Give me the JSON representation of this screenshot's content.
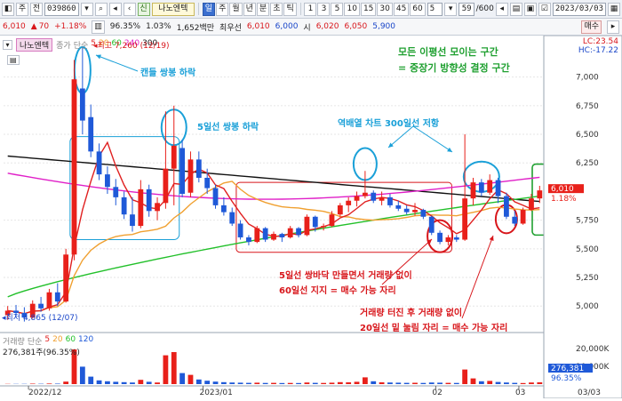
{
  "toolbar": {
    "tab_main": "주",
    "tab_period": "전",
    "code": "039860",
    "badge": "신",
    "stock_name": "나노엔텍",
    "periods": [
      "일",
      "주",
      "월",
      "년",
      "분",
      "초",
      "틱"
    ],
    "active_period": "일",
    "intervals": [
      "1",
      "3",
      "5",
      "10",
      "15",
      "30",
      "45",
      "60"
    ],
    "count": "5",
    "page": "59",
    "page_total": "/600",
    "date": "2023/03/03"
  },
  "quote": {
    "price": "6,010",
    "change": "70",
    "change_rate": "+1.18%",
    "volume_ratio": "96.35%",
    "turnover_rate": "1.03%",
    "amount": "1,652백만",
    "label_low": "최우선",
    "bid": "6,010",
    "ask": "6,000",
    "label_high": "시",
    "open": "6,020",
    "high": "6,050",
    "low": "5,900",
    "sell_btn": "매수"
  },
  "legend": {
    "price_title": "종가",
    "ma_type": "단순",
    "ma_periods": [
      "5",
      "20",
      "60",
      "240",
      "300"
    ],
    "lc": "LC:23.54",
    "hc": "HC:-17.22",
    "vol_title": "거래량",
    "vol_type": "단순",
    "vol_periods": [
      "5",
      "20",
      "60",
      "120"
    ],
    "vol_value": "276,381주(96.35%)"
  },
  "annotations": {
    "high_mark": "최고 7,260 (12/19)",
    "low_mark": "최저 4,865 (12/07)",
    "a1": "캔들 쌍봉 하락",
    "a2": "5일선 쌍봉 하락",
    "a3": "역배열 차트 300일선 저항",
    "a4_line1": "모든 이평선 모이는 구간",
    "a4_line2": "= 중장기 방향성 결정 구간",
    "a5_line1": "5일선 쌍바닥 만들면서 거래량 없이",
    "a5_line2": "60일선 지지 = 매수 가능 자리",
    "a6_line1": "거래량 터진 후 거래량 없이",
    "a6_line2": "20일선 밑 눌림 자리 = 매수 가능 자리"
  },
  "axis": {
    "price_ticks": [
      "7,000",
      "6,750",
      "6,500",
      "6,250",
      "5,750",
      "5,500",
      "5,250",
      "5,000"
    ],
    "current_price": "6,010",
    "current_rate": "1.18%",
    "vol_ticks": [
      "20,000K",
      "10,000K"
    ],
    "vol_current": "276,381",
    "vol_rate": "96.35%",
    "date_ticks": [
      "2022/12",
      "2023/01",
      "02",
      "03"
    ],
    "date_end": "03/03"
  },
  "colors": {
    "up": "#e8201a",
    "down": "#1f59d8",
    "ma5": "#e02020",
    "ma20": "#f0a030",
    "ma60": "#22c02a",
    "ma240": "#e020c8",
    "ma300": "#111111",
    "ann_blue": "#1aa0d8",
    "ann_red": "#d8161b",
    "ann_green": "#1fa030"
  },
  "chart_data": {
    "type": "candlestick",
    "price_range": [
      4800,
      7300
    ],
    "candles": [
      {
        "o": 4920,
        "h": 5000,
        "l": 4880,
        "c": 4960
      },
      {
        "o": 4960,
        "h": 5010,
        "l": 4900,
        "c": 4940
      },
      {
        "o": 4940,
        "h": 4990,
        "l": 4865,
        "c": 4900
      },
      {
        "o": 4900,
        "h": 5050,
        "l": 4890,
        "c": 5020
      },
      {
        "o": 5020,
        "h": 5080,
        "l": 4950,
        "c": 4980
      },
      {
        "o": 4980,
        "h": 5150,
        "l": 4960,
        "c": 5120
      },
      {
        "o": 5120,
        "h": 5200,
        "l": 5000,
        "c": 5040
      },
      {
        "o": 5040,
        "h": 5500,
        "l": 5030,
        "c": 5450
      },
      {
        "o": 5450,
        "h": 7150,
        "l": 5400,
        "c": 6980
      },
      {
        "o": 6900,
        "h": 7260,
        "l": 6500,
        "c": 6620
      },
      {
        "o": 6650,
        "h": 6760,
        "l": 6300,
        "c": 6350
      },
      {
        "o": 6350,
        "h": 6420,
        "l": 6100,
        "c": 6150
      },
      {
        "o": 6150,
        "h": 6220,
        "l": 5980,
        "c": 6040
      },
      {
        "o": 6040,
        "h": 6110,
        "l": 5880,
        "c": 5950
      },
      {
        "o": 5950,
        "h": 6000,
        "l": 5760,
        "c": 5800
      },
      {
        "o": 5800,
        "h": 5950,
        "l": 5650,
        "c": 5700
      },
      {
        "o": 5700,
        "h": 6100,
        "l": 5680,
        "c": 6020
      },
      {
        "o": 6020,
        "h": 6060,
        "l": 5780,
        "c": 5830
      },
      {
        "o": 5830,
        "h": 5950,
        "l": 5750,
        "c": 5900
      },
      {
        "o": 5900,
        "h": 6700,
        "l": 5850,
        "c": 6200
      },
      {
        "o": 6200,
        "h": 6750,
        "l": 5880,
        "c": 6400
      },
      {
        "o": 6380,
        "h": 6450,
        "l": 5950,
        "c": 5980
      },
      {
        "o": 5990,
        "h": 6350,
        "l": 5950,
        "c": 6280
      },
      {
        "o": 6280,
        "h": 6350,
        "l": 6080,
        "c": 6120
      },
      {
        "o": 6120,
        "h": 6200,
        "l": 5980,
        "c": 6030
      },
      {
        "o": 6030,
        "h": 6060,
        "l": 5850,
        "c": 5880
      },
      {
        "o": 5880,
        "h": 5950,
        "l": 5790,
        "c": 5820
      },
      {
        "o": 5820,
        "h": 5860,
        "l": 5700,
        "c": 5720
      },
      {
        "o": 5720,
        "h": 5750,
        "l": 5580,
        "c": 5600
      },
      {
        "o": 5600,
        "h": 5620,
        "l": 5530,
        "c": 5560
      },
      {
        "o": 5560,
        "h": 5700,
        "l": 5550,
        "c": 5680
      },
      {
        "o": 5680,
        "h": 5690,
        "l": 5560,
        "c": 5580
      },
      {
        "o": 5580,
        "h": 5650,
        "l": 5570,
        "c": 5630
      },
      {
        "o": 5630,
        "h": 5640,
        "l": 5560,
        "c": 5600
      },
      {
        "o": 5600,
        "h": 5700,
        "l": 5590,
        "c": 5680
      },
      {
        "o": 5680,
        "h": 5690,
        "l": 5600,
        "c": 5620
      },
      {
        "o": 5620,
        "h": 5800,
        "l": 5610,
        "c": 5780
      },
      {
        "o": 5780,
        "h": 5790,
        "l": 5650,
        "c": 5690
      },
      {
        "o": 5690,
        "h": 5720,
        "l": 5660,
        "c": 5700
      },
      {
        "o": 5700,
        "h": 5830,
        "l": 5690,
        "c": 5800
      },
      {
        "o": 5800,
        "h": 5900,
        "l": 5780,
        "c": 5880
      },
      {
        "o": 5880,
        "h": 5950,
        "l": 5820,
        "c": 5920
      },
      {
        "o": 5920,
        "h": 6000,
        "l": 5870,
        "c": 5960
      },
      {
        "o": 5960,
        "h": 6180,
        "l": 5940,
        "c": 5990
      },
      {
        "o": 5990,
        "h": 6010,
        "l": 5900,
        "c": 5920
      },
      {
        "o": 5920,
        "h": 6000,
        "l": 5880,
        "c": 5950
      },
      {
        "o": 5950,
        "h": 5980,
        "l": 5860,
        "c": 5880
      },
      {
        "o": 5880,
        "h": 5920,
        "l": 5830,
        "c": 5850
      },
      {
        "o": 5850,
        "h": 5880,
        "l": 5800,
        "c": 5820
      },
      {
        "o": 5820,
        "h": 5900,
        "l": 5790,
        "c": 5840
      },
      {
        "o": 5840,
        "h": 5850,
        "l": 5760,
        "c": 5780
      },
      {
        "o": 5780,
        "h": 5790,
        "l": 5620,
        "c": 5640
      },
      {
        "o": 5640,
        "h": 5660,
        "l": 5540,
        "c": 5560
      },
      {
        "o": 5560,
        "h": 5620,
        "l": 5530,
        "c": 5600
      },
      {
        "o": 5600,
        "h": 5620,
        "l": 5560,
        "c": 5580
      },
      {
        "o": 5580,
        "h": 6500,
        "l": 5570,
        "c": 5940
      },
      {
        "o": 5940,
        "h": 6120,
        "l": 5880,
        "c": 6080
      },
      {
        "o": 6080,
        "h": 6110,
        "l": 5960,
        "c": 5990
      },
      {
        "o": 5990,
        "h": 6150,
        "l": 5970,
        "c": 6100
      },
      {
        "o": 6100,
        "h": 6120,
        "l": 5900,
        "c": 5960
      },
      {
        "o": 5960,
        "h": 5990,
        "l": 5760,
        "c": 5780
      },
      {
        "o": 5780,
        "h": 5830,
        "l": 5700,
        "c": 5720
      },
      {
        "o": 5720,
        "h": 5860,
        "l": 5710,
        "c": 5840
      },
      {
        "o": 5840,
        "h": 5980,
        "l": 5830,
        "c": 5940
      },
      {
        "o": 5940,
        "h": 6050,
        "l": 5900,
        "c": 6010
      }
    ],
    "volume_range": [
      0,
      22000
    ],
    "volume_k": [
      120,
      110,
      130,
      260,
      180,
      320,
      260,
      1400,
      19500,
      9800,
      4200,
      2100,
      1600,
      1300,
      1100,
      900,
      2400,
      1300,
      900,
      16200,
      18000,
      6200,
      5200,
      2600,
      1900,
      1400,
      1100,
      900,
      800,
      700,
      800,
      650,
      700,
      600,
      650,
      600,
      900,
      700,
      650,
      800,
      1100,
      1000,
      1300,
      3800,
      1600,
      1000,
      900,
      800,
      700,
      750,
      650,
      900,
      800,
      700,
      650,
      8200,
      3200,
      1600,
      1800,
      1200,
      900,
      700,
      600,
      900,
      1000
    ]
  }
}
